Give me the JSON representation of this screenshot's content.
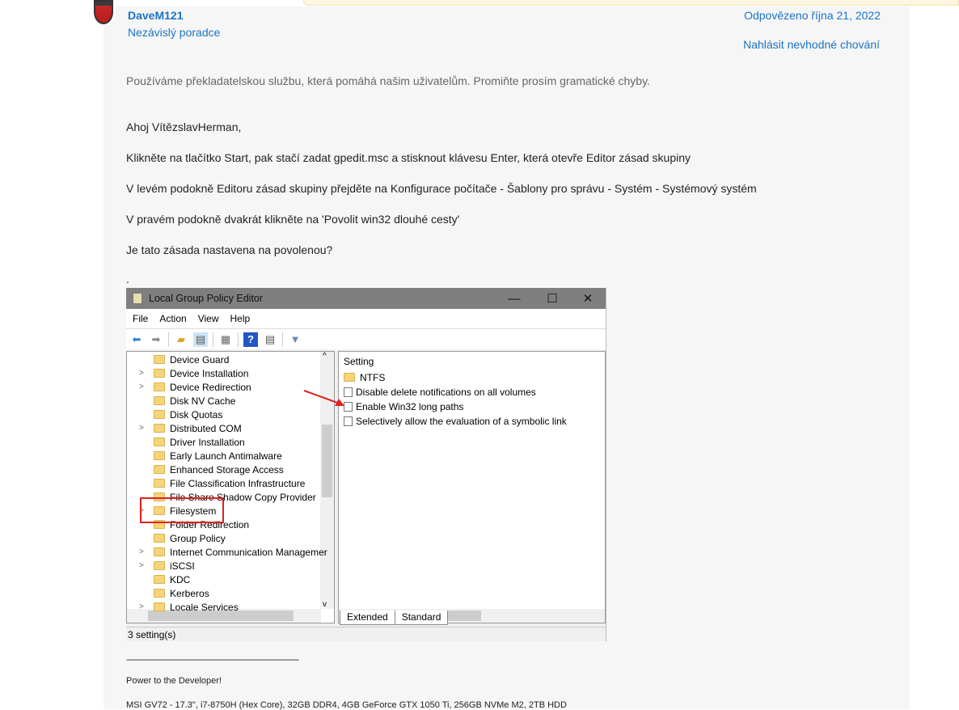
{
  "author": {
    "name": "DaveM121",
    "role": "Nezávislý poradce"
  },
  "meta": {
    "answered": "Odpovězeno října 21, 2022",
    "report": "Nahlásit nevhodné chování"
  },
  "notice": "Používáme překladatelskou službu, která pomáhá našim uživatelům. Promiňte prosím gramatické chyby.",
  "body": [
    "Ahoj VítězslavHerman,",
    "Klikněte na tlačítko Start, pak stačí zadat gpedit.msc a stisknout klávesu Enter, která otevře Editor zásad skupiny",
    "V levém podokně Editoru zásad skupiny přejděte na Konfigurace počítače - Šablony pro správu - Systém - Systémový systém",
    "V pravém podokně dvakrát klikněte na 'Povolit win32 dlouhé cesty'",
    "Je tato zásada nastavena na povolenou?",
    "."
  ],
  "gpedit": {
    "title": "Local Group Policy Editor",
    "menu": [
      "File",
      "Action",
      "View",
      "Help"
    ],
    "tree": [
      "Device Guard",
      "Device Installation",
      "Device Redirection",
      "Disk NV Cache",
      "Disk Quotas",
      "Distributed COM",
      "Driver Installation",
      "Early Launch Antimalware",
      "Enhanced Storage Access",
      "File Classification Infrastructure",
      "File Share Shadow Copy Provider",
      "Filesystem",
      "Folder Redirection",
      "Group Policy",
      "Internet Communication Managemer",
      "iSCSI",
      "KDC",
      "Kerberos",
      "Locale Services"
    ],
    "column": "Setting",
    "settings": [
      "NTFS",
      "Disable delete notifications on all volumes",
      "Enable Win32 long paths",
      "Selectively allow the evaluation of a symbolic link"
    ],
    "tabs": [
      "Extended",
      "Standard"
    ],
    "status": "3 setting(s)"
  },
  "signature": {
    "rule": "--------------------------------------------------------------------------------",
    "line1": "Power to the Developer!",
    "line2": "MSI GV72 - 17.3\", i7-8750H (Hex Core), 32GB DDR4, 4GB GeForce GTX 1050 Ti, 256GB NVMe M2, 2TB HDD"
  },
  "colors": {
    "link": "#1a73c8",
    "highlight": "#e02020"
  }
}
